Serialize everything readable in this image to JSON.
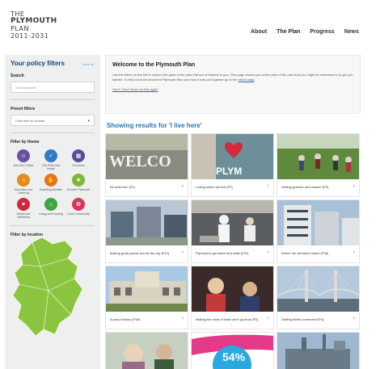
{
  "logo": {
    "line1": "THE",
    "line2": "PLYMOUTH",
    "line3": "PLAN",
    "line4": "2011-2031"
  },
  "nav": [
    {
      "label": "About"
    },
    {
      "label": "The Plan"
    },
    {
      "label": "Progress"
    },
    {
      "label": "News"
    }
  ],
  "sidebar": {
    "title": "Your policy filters",
    "clear_all": "clear all",
    "search_label": "Search",
    "search_placeholder": "Your keywords",
    "preset_label": "Preset filters",
    "preset_value": "Click here to choose",
    "theme_label": "Filter by theme",
    "location_label": "Filter by location",
    "themes": [
      {
        "name": "Arts and Culture",
        "color": "#6a4fa3",
        "icon": "people-icon"
      },
      {
        "name": "City Pride and Image",
        "color": "#2f7bc4",
        "icon": "thumbs-up-icon"
      },
      {
        "name": "Economy",
        "color": "#5a4a9c",
        "icon": "building-icon"
      },
      {
        "name": "Education and Learning",
        "color": "#e58c18",
        "icon": "book-icon"
      },
      {
        "name": "Enabling Activities",
        "color": "#e8731a",
        "icon": "hand-icon"
      },
      {
        "name": "Greener Plymouth",
        "color": "#7cb83b",
        "icon": "leaf-icon"
      },
      {
        "name": "Health and Wellbeing",
        "color": "#d0283a",
        "icon": "heart-icon"
      },
      {
        "name": "Living and Housing",
        "color": "#3fa53f",
        "icon": "house-icon"
      },
      {
        "name": "Local Community",
        "color": "#d8365a",
        "icon": "community-icon"
      }
    ],
    "map_color": "#8bc53f"
  },
  "welcome": {
    "title": "Welcome to the Plymouth Plan",
    "body": "Use the filters on the left to explore the parts of the plan that are of interest to you. This page shows you some parts of the plan that you might be interested in to get you started. To find out more about the Plymouth Plan and how it was put together go to the",
    "link": "about page",
    "dismiss": "Got it. Don't show me this again"
  },
  "results": {
    "title": "Showing results for 'I live here'",
    "cards": [
      {
        "label": "All welcome! (P1)"
      },
      {
        "label": "Loving where we live (P2)"
      },
      {
        "label": "Getting greener and cleaner (P3)"
      },
      {
        "label": "Making great places across the city (P12)"
      },
      {
        "label": "Plymouth's got talent and skills (P20)"
      },
      {
        "label": "Where we will build homes (P35)"
      },
      {
        "label": "A proud history (P26)"
      },
      {
        "label": "Making the most of what we're good at (P5)"
      },
      {
        "label": "Getting better connected (P4)"
      },
      {
        "label": ""
      },
      {
        "label": ""
      },
      {
        "label": ""
      }
    ],
    "badge_text": "54%"
  }
}
